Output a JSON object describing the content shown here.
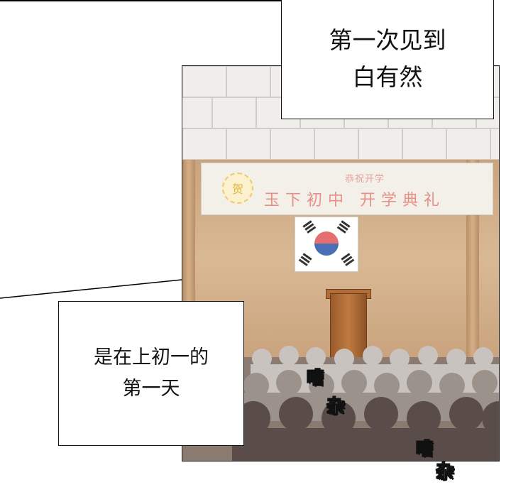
{
  "captions": {
    "top_line1": "第一次见到",
    "top_line2": "白有然",
    "mid_line1": "是在上初一的",
    "mid_line2": "第一天"
  },
  "banner": {
    "subtitle": "恭祝开学",
    "title": "玉下初中 开学典礼",
    "seal_char": "贺"
  },
  "sfx": {
    "a1": "嘈",
    "a2": "杂",
    "b1": "嘈",
    "b2": "杂"
  },
  "colors": {
    "banner_text": "#e59087",
    "seal": "#eccb6a",
    "stage": "#d9b994",
    "crowd": "#5a4d49"
  }
}
